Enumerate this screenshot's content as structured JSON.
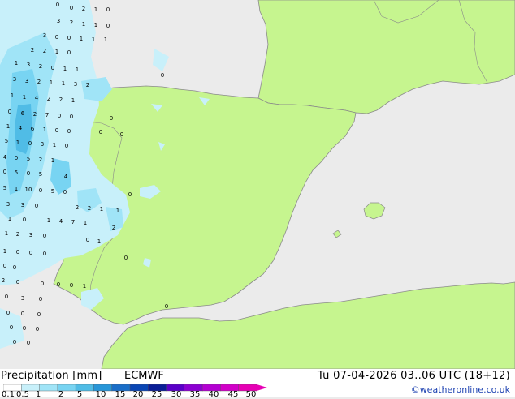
{
  "map": {
    "land_color": "#c6f58f",
    "sea_color": "#ebebeb",
    "precip_values": [
      "0",
      "0",
      "2",
      "1",
      "0",
      "3",
      "2",
      "1",
      "1",
      "0",
      "3",
      "0",
      "0",
      "1",
      "1",
      "1",
      "2",
      "2",
      "1",
      "0",
      "1",
      "3",
      "2",
      "0",
      "1",
      "1",
      "3",
      "3",
      "2",
      "1",
      "1",
      "3",
      "2",
      "1",
      "1",
      "4",
      "2",
      "2",
      "1",
      "0",
      "6",
      "2",
      "7",
      "0",
      "0",
      "1",
      "4",
      "6",
      "1",
      "0",
      "0",
      "5",
      "1",
      "0",
      "3",
      "1",
      "0",
      "4",
      "0",
      "5",
      "2",
      "1",
      "0",
      "5",
      "0",
      "5",
      "4",
      "5",
      "1",
      "10",
      "0",
      "5",
      "0",
      "3",
      "3",
      "0",
      "2",
      "2",
      "1",
      "1",
      "1",
      "0",
      "1",
      "4",
      "7",
      "1",
      "1",
      "2",
      "3",
      "0",
      "0",
      "1",
      "2",
      "1",
      "0",
      "0",
      "0",
      "0",
      "0",
      "0",
      "2",
      "0",
      "0",
      "0",
      "0",
      "1",
      "0",
      "3",
      "0",
      "0",
      "0",
      "0",
      "0",
      "0",
      "0",
      "0",
      "0",
      "0",
      "0",
      "0",
      "0",
      "0",
      "0",
      "0",
      "0",
      "0",
      "0",
      "0",
      "0",
      "0",
      "0",
      "0"
    ]
  },
  "footer": {
    "title": "Precipitation [mm]",
    "model": "ECMWF",
    "run_label": "Tu 07-04-2026 03..06 UTC (18+12)",
    "credit": "©weatheronline.co.uk",
    "legend_labels": [
      "0.1",
      "0.5",
      "1",
      "2",
      "5",
      "10",
      "15",
      "20",
      "25",
      "30",
      "35",
      "40",
      "45",
      "50"
    ],
    "legend_colors": [
      "#ffffff",
      "#c8f0fa",
      "#a0e4f7",
      "#78d4f2",
      "#50bce6",
      "#2896d8",
      "#1a6ec8",
      "#0a46b4",
      "#0a1e96",
      "#5a00c8",
      "#8c00d2",
      "#b400d2",
      "#d200c8",
      "#e600b4"
    ]
  }
}
